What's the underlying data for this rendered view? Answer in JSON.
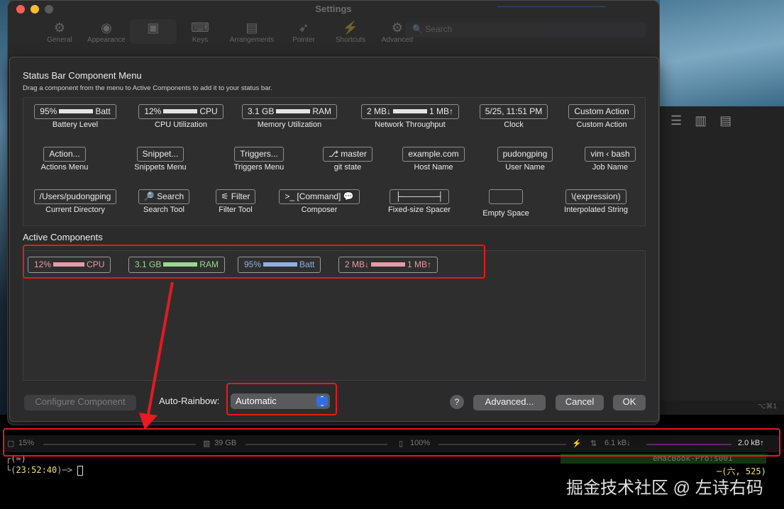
{
  "window": {
    "title": "Settings"
  },
  "toolbar": {
    "items": [
      {
        "label": "General",
        "icon": "⚙"
      },
      {
        "label": "Appearance",
        "icon": "◉"
      },
      {
        "label": "",
        "icon": "▣"
      },
      {
        "label": "Keys",
        "icon": "⌨"
      },
      {
        "label": "Arrangements",
        "icon": "▤"
      },
      {
        "label": "Pointer",
        "icon": "➶"
      },
      {
        "label": "Shortcuts",
        "icon": "⚡"
      },
      {
        "label": "Advanced",
        "icon": "⚙"
      }
    ],
    "search_placeholder": "Search"
  },
  "sheet": {
    "title": "Status Bar Component Menu",
    "subtitle": "Drag a component from the menu to Active Components to add it to your status bar.",
    "components": [
      {
        "chip_pre": "95%",
        "chip_post": "Batt",
        "label": "Battery Level"
      },
      {
        "chip_pre": "12%",
        "chip_post": "CPU",
        "label": "CPU Utilization"
      },
      {
        "chip_pre": "3.1 GB",
        "chip_post": "RAM",
        "label": "Memory Utilization"
      },
      {
        "chip_pre": "2 MB↓",
        "chip_post": "1 MB↑",
        "label": "Network Throughput"
      },
      {
        "chip": "5/25, 11:51 PM",
        "label": "Clock"
      },
      {
        "chip": "Custom Action",
        "label": "Custom Action"
      },
      {
        "chip": "Action...",
        "label": "Actions Menu"
      },
      {
        "chip": "Snippet...",
        "label": "Snippets Menu"
      },
      {
        "chip": "Triggers...",
        "label": "Triggers Menu"
      },
      {
        "chip": "⎇ master",
        "label": "git state"
      },
      {
        "chip": "example.com",
        "label": "Host Name"
      },
      {
        "chip": "pudongping",
        "label": "User Name"
      },
      {
        "chip": "vim ‹ bash",
        "label": "Job Name"
      },
      {
        "chip": "/Users/pudongping",
        "label": "Current Directory"
      },
      {
        "chip": "🔎 Search",
        "label": "Search Tool"
      },
      {
        "chip": "⚟ Filter",
        "label": "Filter Tool"
      },
      {
        "chip": ">_ [Command] 💬",
        "label": "Composer"
      },
      {
        "chip": "├──────┤",
        "label": "Fixed-size Spacer"
      },
      {
        "chip": "",
        "label": "Empty Space"
      },
      {
        "chip": "\\(expression)",
        "label": "Interpolated String"
      }
    ],
    "active_title": "Active Components",
    "active": [
      {
        "pre": "12%",
        "post": "CPU",
        "color": "#e89aa6"
      },
      {
        "pre": "3.1 GB",
        "post": "RAM",
        "color": "#98d98e"
      },
      {
        "pre": "95%",
        "post": "Batt",
        "color": "#8fb0e6"
      },
      {
        "pre": "2 MB↓",
        "post": "1 MB↑",
        "color": "#e89aa6"
      }
    ],
    "configure_label": "Configure Component",
    "auto_rainbow_label": "Auto-Rainbow:",
    "auto_rainbow_value": "Automatic",
    "help_label": "?",
    "advanced_label": "Advanced...",
    "cancel_label": "Cancel",
    "ok_label": "OK"
  },
  "terminal": {
    "status": {
      "cpu": "15%",
      "ram": "39 GB",
      "batt": "100%",
      "net_down": "6.1 kB↓",
      "net_up": "2.0 kB↑"
    },
    "tab_hint": "⌥⌘1",
    "prompt_time": "23:52:40",
    "prompt_right": "六, 525",
    "host_text": "eMacBook-Pro:s001"
  },
  "watermark": "掘金技术社区 @ 左诗右码",
  "colors": {
    "annotation_red": "#e8191f",
    "accent_blue": "#2f6fe0"
  }
}
